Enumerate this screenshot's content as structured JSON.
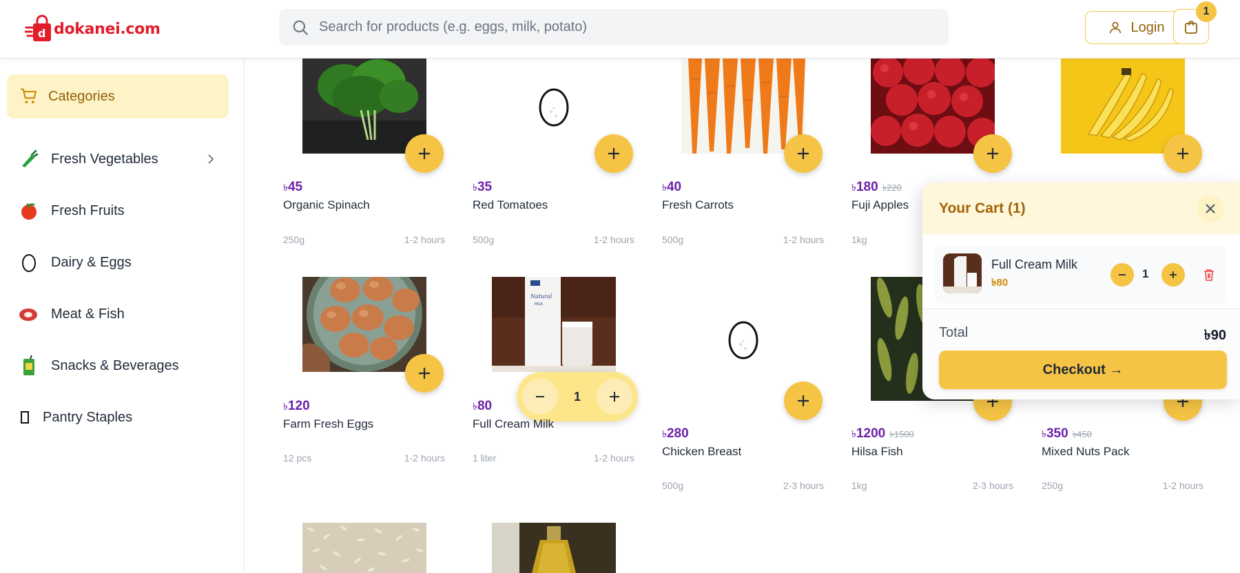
{
  "header": {
    "logo_text": "dokanei.com",
    "search_placeholder": "Search for products (e.g. eggs, milk, potato)",
    "login_label": "Login",
    "cart_count": "1"
  },
  "sidebar": {
    "title": "Categories",
    "items": [
      {
        "label": "Fresh Vegetables",
        "icon": "vegetable-icon"
      },
      {
        "label": "Fresh Fruits",
        "icon": "fruit-icon"
      },
      {
        "label": "Dairy & Eggs",
        "icon": "egg-icon"
      },
      {
        "label": "Meat & Fish",
        "icon": "meat-icon"
      },
      {
        "label": "Snacks & Beverages",
        "icon": "beverage-icon"
      },
      {
        "label": "Pantry Staples",
        "icon": "pantry-icon"
      }
    ]
  },
  "currency": "৳",
  "products": [
    {
      "price": "45",
      "old_price": "",
      "name": "Organic Spinach",
      "qty": "250g",
      "eta": "1-2 hours"
    },
    {
      "price": "35",
      "old_price": "",
      "name": "Red Tomatoes",
      "qty": "500g",
      "eta": "1-2 hours"
    },
    {
      "price": "40",
      "old_price": "",
      "name": "Fresh Carrots",
      "qty": "500g",
      "eta": "1-2 hours"
    },
    {
      "price": "180",
      "old_price": "220",
      "name": "Fuji Apples",
      "qty": "1kg",
      "eta": ""
    },
    {
      "price": "",
      "old_price": "",
      "name": "",
      "qty": "",
      "eta": ""
    },
    {
      "price": "120",
      "old_price": "",
      "name": "Farm Fresh Eggs",
      "qty": "12 pcs",
      "eta": "1-2 hours"
    },
    {
      "price": "80",
      "old_price": "",
      "name": "Full Cream Milk",
      "qty": "1 liter",
      "eta": "1-2 hours"
    },
    {
      "price": "280",
      "old_price": "",
      "name": "Chicken Breast",
      "qty": "500g",
      "eta": "2-3 hours"
    },
    {
      "price": "1200",
      "old_price": "1500",
      "name": "Hilsa Fish",
      "qty": "1kg",
      "eta": "2-3 hours"
    },
    {
      "price": "350",
      "old_price": "450",
      "name": "Mixed Nuts Pack",
      "qty": "250g",
      "eta": "1-2 hours"
    }
  ],
  "milk_stepper_qty": "1",
  "cart": {
    "title": "Your Cart (1)",
    "item_name": "Full Cream Milk",
    "item_price": "৳80",
    "item_qty": "1",
    "total_label": "Total",
    "total_value": "৳90",
    "checkout_label": "Checkout →"
  },
  "colors": {
    "accent": "#f6c445",
    "price": "#6b21a8",
    "brand": "#e11d2a"
  }
}
